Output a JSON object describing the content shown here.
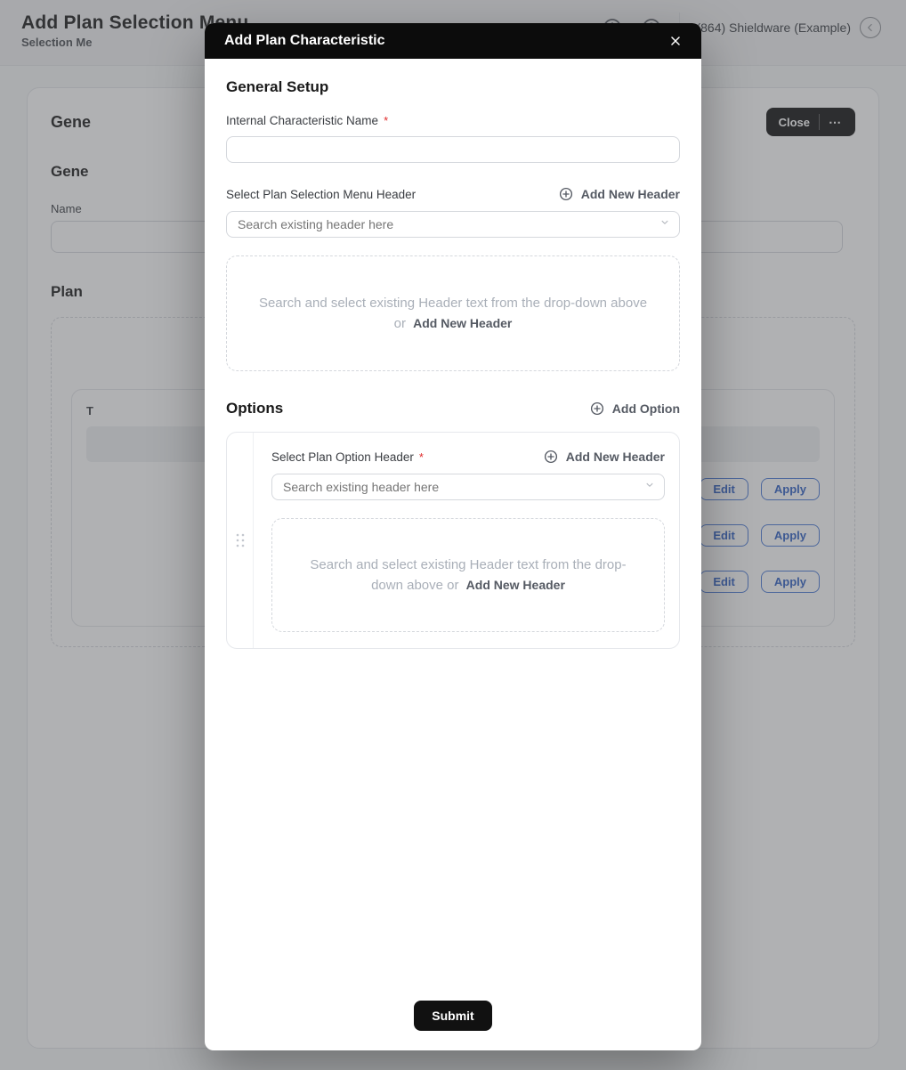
{
  "topbar": {
    "title": "Add Plan Selection Menu",
    "subtitle": "Selection Me",
    "account_label": "(864) Shieldware (Example)"
  },
  "bg": {
    "gene1": "Gene",
    "gene2": "Gene",
    "name_label": "Name",
    "plan_label": "Plan",
    "t_label": "T",
    "close_label": "Close",
    "edit_label": "Edit",
    "apply_label": "Apply"
  },
  "modal": {
    "title": "Add Plan Characteristic",
    "general_heading": "General Setup",
    "internal_name_label": "Internal Characteristic Name",
    "select_header_label": "Select Plan Selection Menu Header",
    "add_new_header": "Add New Header",
    "search_placeholder": "Search existing header here",
    "dashed_text": "Search and select existing Header text from the drop-down above or",
    "dashed_link": "Add New Header",
    "options_heading": "Options",
    "add_option": "Add Option",
    "option": {
      "select_label": "Select Plan Option Header",
      "add_new_header": "Add New Header",
      "search_placeholder": "Search existing header here",
      "dashed_text": "Search and select existing Header text from the drop-down above or",
      "dashed_link": "Add New Header"
    },
    "submit_label": "Submit"
  }
}
